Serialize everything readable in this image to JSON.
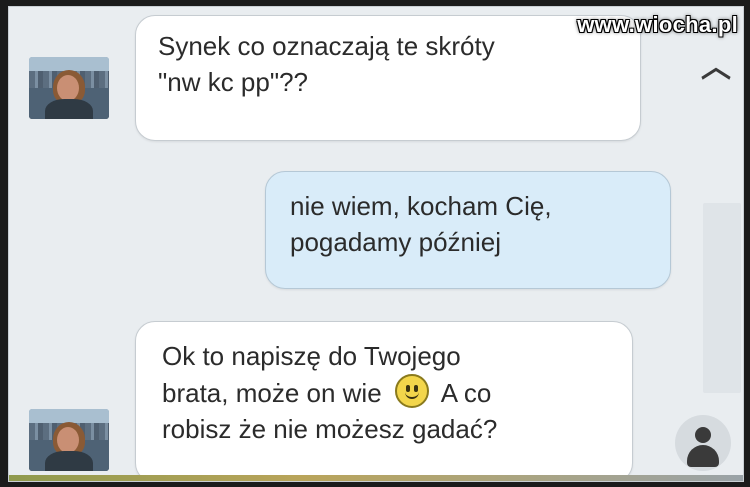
{
  "watermark": "www.wiocha.pl",
  "messages": [
    {
      "from": "incoming",
      "lines": [
        "Synek co oznaczają te skróty",
        "\"nw kc pp\"??"
      ]
    },
    {
      "from": "outgoing",
      "lines": [
        "nie wiem, kocham Cię,",
        "pogadamy później"
      ]
    },
    {
      "from": "incoming",
      "lines": [
        "Ok to napiszę do Twojego",
        "brata, może on wie",
        "A co",
        "robisz że nie możesz gadać?"
      ]
    }
  ],
  "icons": {
    "scroll_up": "chevron-up-icon",
    "smiley": "smiley-emoji-icon",
    "user": "user-icon"
  },
  "colors": {
    "background": "#e9edf0",
    "incoming_bubble": "#ffffff",
    "outgoing_bubble": "#d9ecf9"
  }
}
